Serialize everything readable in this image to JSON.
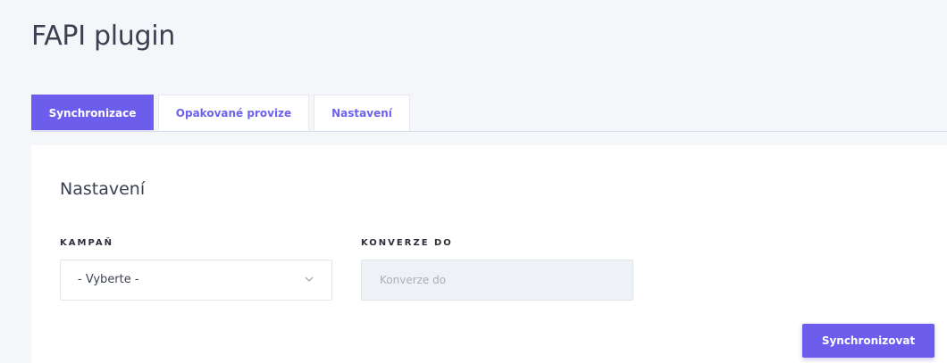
{
  "page": {
    "title": "FAPI plugin"
  },
  "tabs": [
    {
      "label": "Synchronizace",
      "active": true
    },
    {
      "label": "Opakované provize",
      "active": false
    },
    {
      "label": "Nastavení",
      "active": false
    }
  ],
  "settings_card": {
    "title": "Nastavení",
    "campaign_field": {
      "label": "KAMPAŇ",
      "selected_value": "- Vyberte -",
      "icon": "chevron-down-icon"
    },
    "conversion_field": {
      "label": "KONVERZE DO",
      "value": "",
      "placeholder": "Konverze do",
      "disabled": true
    },
    "sync_button_label": "Synchronizovat"
  },
  "colors": {
    "accent": "#6d5dec",
    "background": "#f4f6fa",
    "card": "#ffffff",
    "disabled_input": "#eef1f5"
  }
}
